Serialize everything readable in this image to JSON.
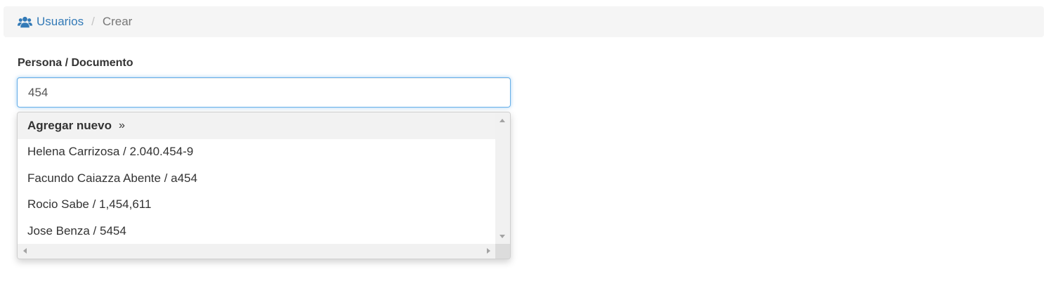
{
  "breadcrumb": {
    "icon": "users-icon",
    "link_label": "Usuarios",
    "separator": "/",
    "current": "Crear"
  },
  "form": {
    "label": "Persona / Documento",
    "value": "454"
  },
  "dropdown": {
    "add_new_label": "Agregar nuevo",
    "add_new_icon": "double-chevron-right-icon",
    "add_new_glyph": "»",
    "items": [
      "Helena Carrizosa / 2.040.454-9",
      "Facundo Caiazza Abente / a454",
      "Rocio Sabe / 1,454,611",
      "Jose Benza / 5454"
    ]
  },
  "colors": {
    "link": "#337ab7",
    "breadcrumb_bg": "#f5f5f5",
    "focus_border": "#66afe9"
  }
}
